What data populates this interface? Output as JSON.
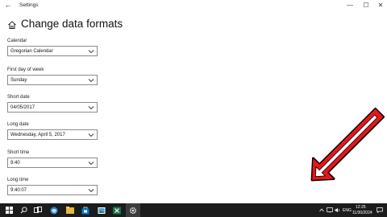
{
  "window": {
    "title": "Settings",
    "back_glyph": "←",
    "minimize_glyph": "—",
    "maximize_glyph": "☐",
    "close_glyph": "✕"
  },
  "header": {
    "title": "Change data formats",
    "icon": "home-icon"
  },
  "formats": [
    {
      "label": "Calendar",
      "value": "Gregorian Calendar"
    },
    {
      "label": "First day of week",
      "value": "Sunday"
    },
    {
      "label": "Short date",
      "value": "04/05/2017"
    },
    {
      "label": "Long date",
      "value": "Wednesday, April 5, 2017"
    },
    {
      "label": "Short time",
      "value": "9:40"
    },
    {
      "label": "Long time",
      "value": "9:40:07"
    }
  ],
  "overlay": {
    "arrow_color": "#e8141b",
    "arrow_outline": "#000000",
    "arrow_inner": "#ffffff"
  },
  "taskbar": {
    "icons": [
      "windows-icon",
      "search-icon",
      "task-view-icon",
      "edge-icon",
      "file-explorer-icon",
      "store-icon",
      "photos-icon",
      "excel-icon",
      "settings-icon"
    ],
    "tray": {
      "language": "ENG",
      "time": "12:25",
      "date": "11/30/2024"
    }
  }
}
